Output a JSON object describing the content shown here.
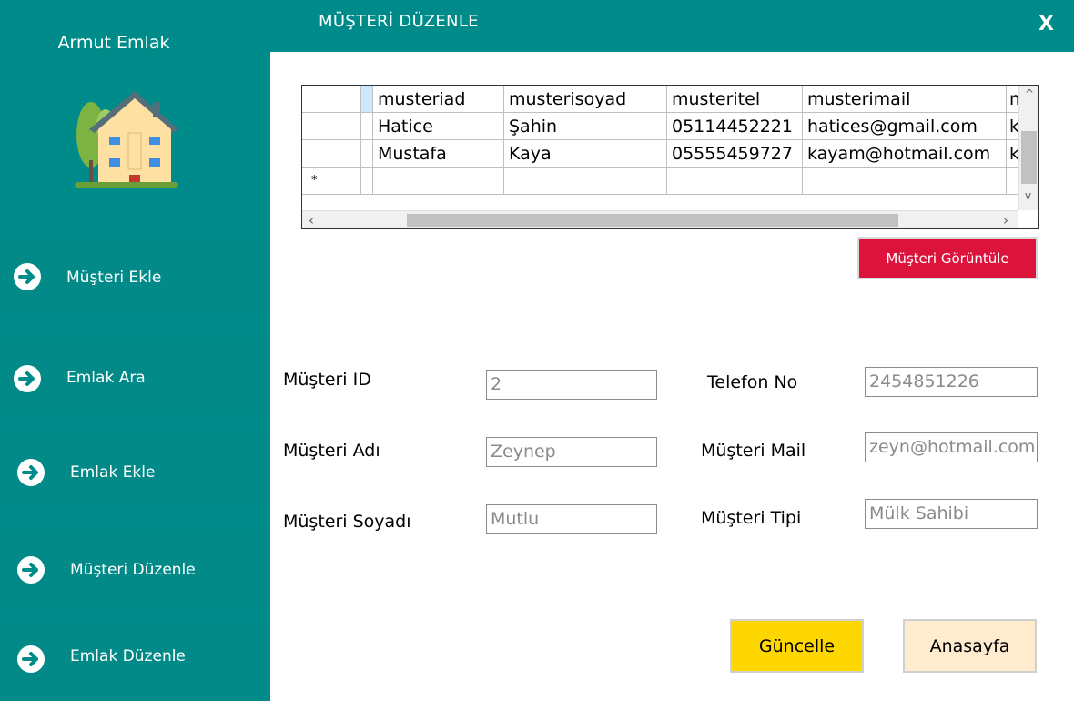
{
  "sidebar": {
    "app_title": "Armut Emlak",
    "logo_icon": "house-logo-icon",
    "items": [
      {
        "label": "Müşteri Ekle",
        "icon": "arrow-right-circle-icon"
      },
      {
        "label": "Emlak Ara",
        "icon": "arrow-right-circle-icon"
      },
      {
        "label": "Emlak Ekle",
        "icon": "arrow-right-circle-icon"
      },
      {
        "label": "Müşteri Düzenle",
        "icon": "arrow-right-circle-icon"
      },
      {
        "label": "Emlak Düzenle",
        "icon": "arrow-right-circle-icon"
      }
    ]
  },
  "header": {
    "title": "MÜŞTERİ DÜZENLE",
    "close_label": "X"
  },
  "grid": {
    "columns": [
      "musteriad",
      "musterisoyad",
      "musteritel",
      "musterimail",
      "m"
    ],
    "rows": [
      {
        "musteriad": "Hatice",
        "musterisoyad": "Şahin",
        "musteritel": "05114452221",
        "musterimail": "hatices@gmail.com",
        "extra": "k"
      },
      {
        "musteriad": "Mustafa",
        "musterisoyad": "Kaya",
        "musteritel": "05555459727",
        "musterimail": "kayam@hotmail.com",
        "extra": "k"
      }
    ],
    "new_row_marker": "*",
    "scroll_left": "‹",
    "scroll_right": "›",
    "scroll_up": "^",
    "scroll_down": "v"
  },
  "buttons": {
    "view_customers": "Müşteri Görüntüle",
    "update": "Güncelle",
    "home": "Anasayfa"
  },
  "form": {
    "customer_id_label": "Müşteri ID",
    "customer_id_value": "2",
    "phone_label": "Telefon No",
    "phone_value": "2454851226",
    "name_label": "Müşteri Adı",
    "name_value": "Zeynep",
    "mail_label": "Müşteri Mail",
    "mail_value": "zeyn@hotmail.com",
    "surname_label": "Müşteri Soyadı",
    "surname_value": "Mutlu",
    "type_label": "Müşteri Tipi",
    "type_value": "Mülk Sahibi"
  },
  "colors": {
    "teal": "#008b8b",
    "crimson": "#dc143c",
    "gold": "#ffd700",
    "blanched_almond": "#ffebcd"
  }
}
